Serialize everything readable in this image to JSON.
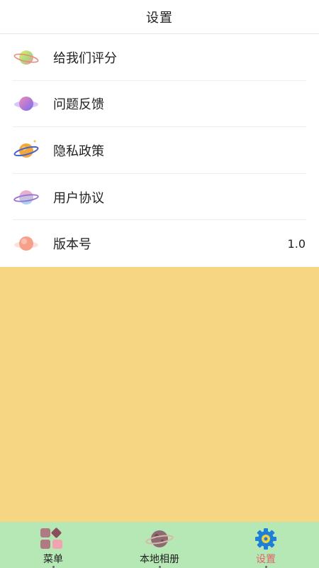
{
  "header": {
    "title": "设置"
  },
  "menu": {
    "items": [
      {
        "label": "给我们评分",
        "icon": "planet-rainbow-icon",
        "value": ""
      },
      {
        "label": "问题反馈",
        "icon": "planet-purple-icon",
        "value": ""
      },
      {
        "label": "隐私政策",
        "icon": "planet-orange-icon",
        "value": ""
      },
      {
        "label": "用户协议",
        "icon": "planet-pink-icon",
        "value": ""
      },
      {
        "label": "版本号",
        "icon": "planet-peach-icon",
        "value": "1.0"
      }
    ]
  },
  "tabbar": {
    "tabs": [
      {
        "label": "菜单",
        "icon": "grid-menu-icon",
        "active": false
      },
      {
        "label": "本地相册",
        "icon": "planet-album-icon",
        "active": false
      },
      {
        "label": "设置",
        "icon": "gear-icon",
        "active": true
      }
    ]
  },
  "colors": {
    "content_background": "#f6d682",
    "tabbar_background": "#b5e8b5",
    "active_tab": "#e0646a"
  }
}
